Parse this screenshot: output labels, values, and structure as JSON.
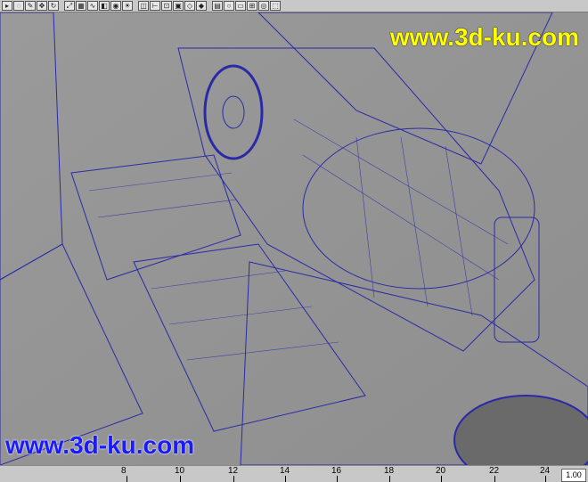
{
  "watermark": {
    "top": "www.3d-ku.com",
    "bottom": "www.3d-ku.com"
  },
  "toolbar": {
    "tools": [
      "select",
      "lasso",
      "paint",
      "move",
      "rotate",
      "scale",
      "grid",
      "curve",
      "surface",
      "render",
      "light",
      "camera",
      "measure",
      "snap",
      "cube",
      "wire",
      "shade",
      "texture",
      "bulb",
      "display",
      "grid-snap",
      "xray",
      "frame"
    ]
  },
  "timeline": {
    "ticks": [
      "8",
      "10",
      "12",
      "14",
      "16",
      "18",
      "20",
      "22",
      "24"
    ],
    "frame_value": "1.00"
  },
  "colors": {
    "wire": "#2a2aa8",
    "mesh": "#6b6b6b",
    "sky": "#8a8a8a",
    "watermark_top": "#ffff00",
    "watermark_bottom": "#1a1aff"
  }
}
